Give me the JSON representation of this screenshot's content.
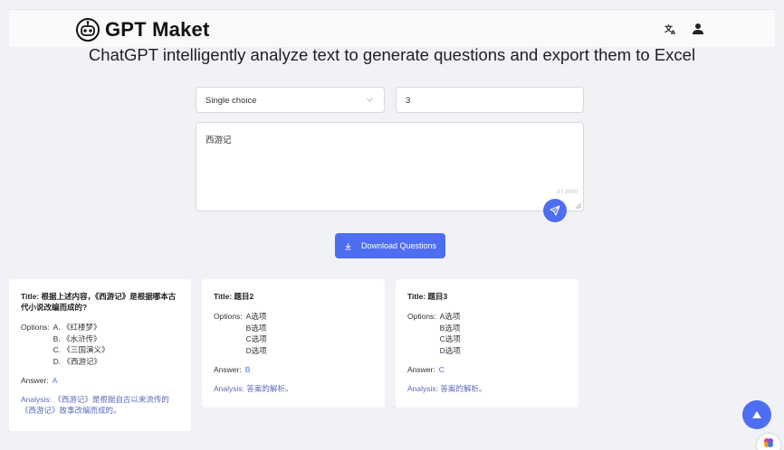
{
  "header": {
    "brand": "GPT Maket",
    "translate_icon": "translate-icon",
    "user_icon": "user-icon"
  },
  "page": {
    "title": "ChatGPT intelligently analyze text to generate questions and export them to Excel"
  },
  "form": {
    "question_type": "Single choice",
    "question_count": "3",
    "text": "西游记",
    "counter": "3 / 2000",
    "download_label": "Download Questions"
  },
  "cards": [
    {
      "title_label": "Title:",
      "title": "根据上述内容，《西游记》是根据哪本古代小说改编而成的?",
      "options_label": "Options:",
      "options": [
        "A. 《红楼梦》",
        "B. 《水浒传》",
        "C. 《三国演义》",
        "D. 《西游记》"
      ],
      "answer_label": "Answer:",
      "answer": "A",
      "analysis_label": "Analysis:",
      "analysis": "《西游记》是根据自古以来流传的《西游记》故事改编而成的。"
    },
    {
      "title_label": "Title:",
      "title": "题目2",
      "options_label": "Options:",
      "options": [
        "A选项",
        "B选项",
        "C选项",
        "D选项"
      ],
      "answer_label": "Answer:",
      "answer": "B",
      "analysis_label": "Analysis:",
      "analysis": "答案的解析。"
    },
    {
      "title_label": "Title:",
      "title": "题目3",
      "options_label": "Options:",
      "options": [
        "A选项",
        "B选项",
        "C选项",
        "D选项"
      ],
      "answer_label": "Answer:",
      "answer": "C",
      "analysis_label": "Analysis:",
      "analysis": "答案的解析。"
    }
  ],
  "colors": {
    "accent": "#4e6ef2",
    "background": "#f1f2f5",
    "analysis_text": "#5b6bb8"
  }
}
